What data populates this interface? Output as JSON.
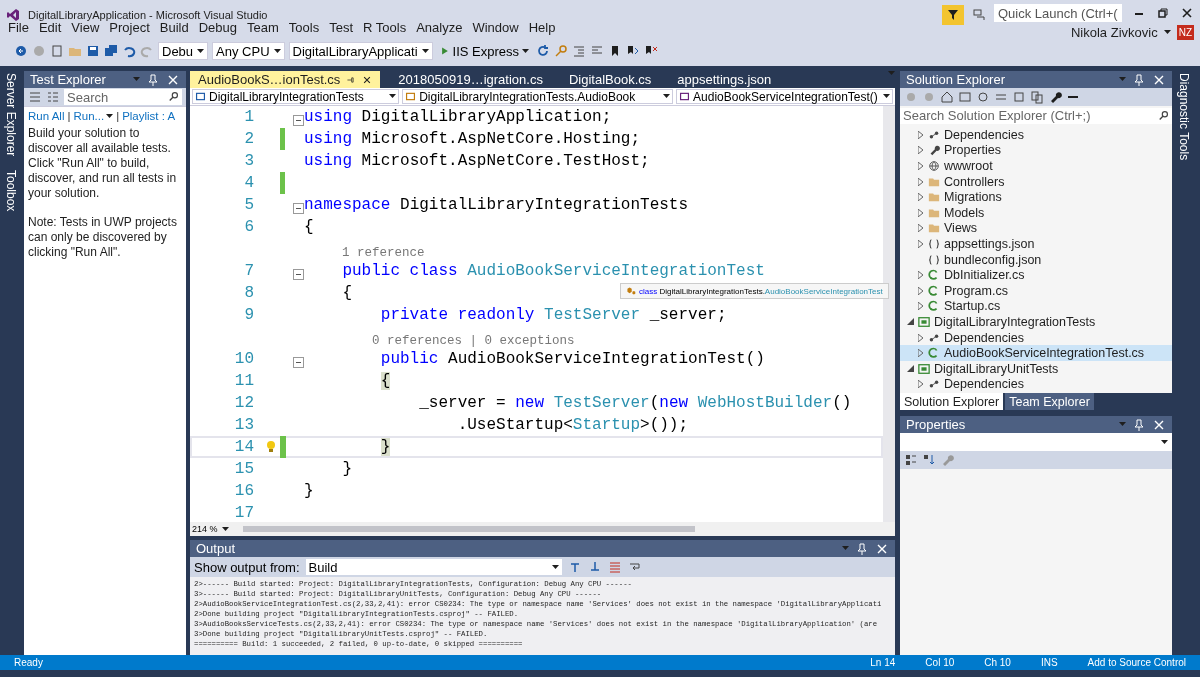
{
  "window": {
    "title": "DigitalLibraryApplication - Microsoft Visual Studio",
    "quick_launch": {
      "placeholder": "Quick Launch (Ctrl+("
    },
    "user": {
      "name": "Nikola Zivkovic",
      "initials": "NZ"
    }
  },
  "menu": [
    "File",
    "Edit",
    "View",
    "Project",
    "Build",
    "Debug",
    "Team",
    "Tools",
    "Test",
    "R Tools",
    "Analyze",
    "Window",
    "Help"
  ],
  "toolbar": {
    "configuration": "Debu",
    "platform": "Any CPU",
    "startup_project": "DigitalLibraryApplicati",
    "run_target": "IIS Express"
  },
  "side_tabs_left": [
    "Server Explorer",
    "Toolbox"
  ],
  "side_tabs_right": [
    "Diagnostic Tools"
  ],
  "test_explorer": {
    "title": "Test Explorer",
    "search": {
      "placeholder": "Search"
    },
    "links": [
      "Run All",
      "Run...",
      "Playlist : A"
    ],
    "link_separator": "|",
    "message": "Build your solution to discover all available tests. Click \"Run All\" to build, discover, and run all tests in your solution.",
    "note": "Note: Tests in UWP projects can only be discovered by clicking \"Run All\"."
  },
  "editor": {
    "tabs": [
      {
        "label": "AudioBookS…ionTest.cs",
        "selected": true
      },
      {
        "label": "2018050919…igration.cs",
        "selected": false
      },
      {
        "label": "DigitalBook.cs",
        "selected": false
      },
      {
        "label": "appsettings.json",
        "selected": false
      }
    ],
    "nav": [
      "DigitalLibraryIntegrationTests",
      "DigitalLibraryIntegrationTests.AudioBook",
      "AudioBookServiceIntegrationTest()"
    ],
    "lines": [
      {
        "kind": "code",
        "number": "1",
        "fold": true,
        "changed": false,
        "tokens": [
          {
            "t": "using",
            "kind": "keyword"
          },
          {
            "t": " DigitalLibraryApplication;",
            "kind": "plain"
          }
        ]
      },
      {
        "kind": "code",
        "number": "2",
        "fold": false,
        "changed": true,
        "tokens": [
          {
            "t": "using",
            "kind": "keyword"
          },
          {
            "t": " Microsoft.AspNetCore.Hosting;",
            "kind": "plain"
          }
        ]
      },
      {
        "kind": "code",
        "number": "3",
        "fold": false,
        "changed": false,
        "tokens": [
          {
            "t": "using",
            "kind": "keyword"
          },
          {
            "t": " Microsoft.AspNetCore.TestHost;",
            "kind": "plain"
          }
        ]
      },
      {
        "kind": "code",
        "number": "4",
        "fold": false,
        "changed": true
      },
      {
        "kind": "code",
        "number": "5",
        "fold": true,
        "changed": false,
        "tokens": [
          {
            "t": "namespace",
            "kind": "keyword"
          },
          {
            "t": " DigitalLibraryIntegrationTests",
            "kind": "plain"
          }
        ]
      },
      {
        "kind": "code",
        "number": "6",
        "fold": false,
        "changed": false,
        "tokens": [
          {
            "t": "{",
            "kind": "plain"
          }
        ]
      },
      {
        "kind": "lens",
        "text": "    1 reference"
      },
      {
        "kind": "code",
        "number": "7",
        "fold": true,
        "changed": false,
        "tokens": [
          {
            "t": "    public class",
            "kind": "keyword"
          },
          {
            "t": " AudioBookServiceIntegrationTest",
            "kind": "type"
          }
        ]
      },
      {
        "kind": "code",
        "number": "8",
        "fold": false,
        "changed": false,
        "tokens": [
          {
            "t": "    {",
            "kind": "plain"
          }
        ]
      },
      {
        "kind": "code",
        "number": "9",
        "fold": false,
        "changed": false,
        "tokens": [
          {
            "t": "        private readonly",
            "kind": "keyword"
          },
          {
            "t": " TestServer",
            "kind": "type"
          },
          {
            "t": " _server;",
            "kind": "plain"
          }
        ]
      },
      {
        "kind": "lens",
        "text": "        0 references | 0 exceptions"
      },
      {
        "kind": "code",
        "number": "10",
        "fold": true,
        "changed": false,
        "tokens": [
          {
            "t": "        public",
            "kind": "keyword"
          },
          {
            "t": " AudioBookServiceIntegrationTest()",
            "kind": "plain"
          }
        ]
      },
      {
        "kind": "code",
        "number": "11",
        "fold": false,
        "changed": false,
        "tokens": [
          {
            "t": "        {",
            "kind": "brace_match"
          }
        ]
      },
      {
        "kind": "code",
        "number": "12",
        "fold": false,
        "changed": false,
        "tokens": [
          {
            "t": "            _server = ",
            "kind": "plain"
          },
          {
            "t": "new",
            "kind": "keyword"
          },
          {
            "t": " TestServer",
            "kind": "type"
          },
          {
            "t": "(",
            "kind": "plain"
          },
          {
            "t": "new",
            "kind": "keyword"
          },
          {
            "t": " WebHostBuilder",
            "kind": "type"
          },
          {
            "t": "()",
            "kind": "plain"
          }
        ]
      },
      {
        "kind": "code",
        "number": "13",
        "fold": false,
        "changed": false,
        "tokens": [
          {
            "t": "                .UseStartup<",
            "kind": "plain"
          },
          {
            "t": "Startup",
            "kind": "type"
          },
          {
            "t": ">());",
            "kind": "plain"
          }
        ]
      },
      {
        "kind": "code",
        "number": "14",
        "fold": false,
        "changed": true,
        "current": true,
        "lightbulb": true,
        "tokens": [
          {
            "t": "        }",
            "kind": "brace_match"
          }
        ]
      },
      {
        "kind": "code",
        "number": "15",
        "fold": false,
        "changed": false,
        "tokens": [
          {
            "t": "    }",
            "kind": "plain"
          }
        ]
      },
      {
        "kind": "code",
        "number": "16",
        "fold": false,
        "changed": false,
        "tokens": [
          {
            "t": "}",
            "kind": "plain"
          }
        ]
      },
      {
        "kind": "code",
        "number": "17",
        "fold": false,
        "changed": false
      }
    ],
    "tooltip": {
      "keyword": "class",
      "namespace": "DigitalLibraryIntegrationTests.",
      "name": "AudioBookServiceIntegrationTest"
    },
    "zoom": "214 %"
  },
  "output": {
    "title": "Output",
    "source_label": "Show output from:",
    "source": "Build",
    "lines": [
      "2>------ Build started: Project: DigitalLibraryIntegrationTests, Configuration: Debug Any CPU ------",
      "3>------ Build started: Project: DigitalLibraryUnitTests, Configuration: Debug Any CPU ------",
      "2>AudioBookServiceIntegrationTest.cs(2,33,2,41): error CS0234: The type or namespace name 'Services' does not exist in the namespace 'DigitalLibraryApplicati",
      "2>Done building project \"DigitalLibraryIntegrationTests.csproj\" -- FAILED.",
      "3>AudioBooksServiceTests.cs(2,33,2,41): error CS0234: The type or namespace name 'Services' does not exist in the namespace 'DigitalLibraryApplication' (are",
      "3>Done building project \"DigitalLibraryUnitTests.csproj\" -- FAILED.",
      "========== Build: 1 succeeded, 2 failed, 0 up-to-date, 0 skipped =========="
    ]
  },
  "solution_explorer": {
    "title": "Solution Explorer",
    "search": {
      "placeholder": "Search Solution Explorer (Ctrl+;)"
    },
    "open_project_items": [
      {
        "label": "Dependencies",
        "kind": "dependencies",
        "expanded": false,
        "selected": false
      },
      {
        "label": "Properties",
        "kind": "properties",
        "expanded": false,
        "selected": false
      },
      {
        "label": "wwwroot",
        "kind": "globe",
        "expanded": false,
        "selected": false
      },
      {
        "label": "Controllers",
        "kind": "folder",
        "expanded": false,
        "selected": false
      },
      {
        "label": "Migrations",
        "kind": "folder",
        "expanded": false,
        "selected": false
      },
      {
        "label": "Models",
        "kind": "folder",
        "expanded": false,
        "selected": false
      },
      {
        "label": "Views",
        "kind": "folder",
        "expanded": false,
        "selected": false
      },
      {
        "label": "appsettings.json",
        "kind": "json",
        "expanded": false,
        "selected": false
      },
      {
        "label": "bundleconfig.json",
        "kind": "json",
        "selected": false
      },
      {
        "label": "DbInitializer.cs",
        "kind": "csharp",
        "expanded": false,
        "selected": false
      },
      {
        "label": "Program.cs",
        "kind": "csharp",
        "expanded": false,
        "selected": false
      },
      {
        "label": "Startup.cs",
        "kind": "csharp",
        "expanded": false,
        "selected": false
      }
    ],
    "projects": [
      {
        "label": "DigitalLibraryIntegrationTests",
        "kind": "project",
        "expanded": true,
        "selected": false,
        "children": [
          {
            "label": "Dependencies",
            "kind": "dependencies",
            "expanded": false,
            "selected": false
          },
          {
            "label": "AudioBookServiceIntegrationTest.cs",
            "kind": "csharp",
            "expanded": false,
            "selected": true
          }
        ]
      },
      {
        "label": "DigitalLibraryUnitTests",
        "kind": "project",
        "expanded": true,
        "selected": false,
        "children": [
          {
            "label": "Dependencies",
            "kind": "dependencies",
            "expanded": false,
            "selected": false
          }
        ]
      }
    ],
    "tabs": [
      {
        "label": "Solution Explorer",
        "selected": true
      },
      {
        "label": "Team Explorer",
        "selected": false
      }
    ]
  },
  "properties": {
    "title": "Properties"
  },
  "status_bar": [
    "Ready",
    "Ln 14",
    "Col 10",
    "Ch 10",
    "INS",
    "Add to Source Control"
  ]
}
